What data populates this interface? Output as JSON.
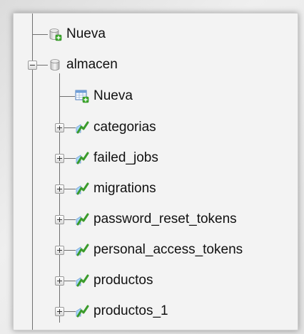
{
  "tree": {
    "root_new": {
      "label": "Nueva",
      "icon": "new-database-icon"
    },
    "database": {
      "label": "almacen",
      "icon": "database-icon",
      "expanded": true,
      "new_table": {
        "label": "Nueva",
        "icon": "new-table-icon"
      },
      "tables": [
        {
          "label": "categorias",
          "icon": "table-icon"
        },
        {
          "label": "failed_jobs",
          "icon": "table-icon"
        },
        {
          "label": "migrations",
          "icon": "table-icon"
        },
        {
          "label": "password_reset_tokens",
          "icon": "table-icon"
        },
        {
          "label": "personal_access_tokens",
          "icon": "table-icon"
        },
        {
          "label": "productos",
          "icon": "table-icon"
        },
        {
          "label": "productos_1",
          "icon": "table-icon"
        }
      ]
    }
  },
  "colors": {
    "panel_background": "#f3f3f3",
    "connector_line": "#707070",
    "table_icon_green": "#3a9b2b",
    "new_badge_green": "#3caa2c"
  }
}
